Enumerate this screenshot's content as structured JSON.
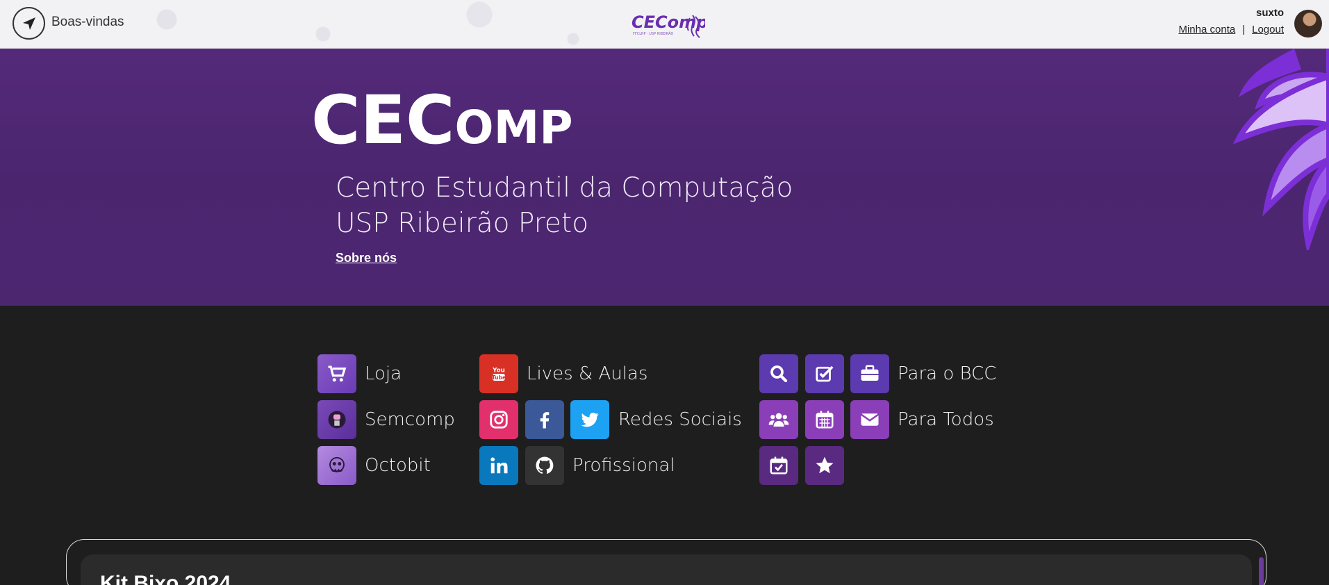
{
  "header": {
    "welcome_label": "Boas-vindas",
    "logo_text": "CEComp",
    "user_name": "suxto",
    "my_account_label": "Minha conta",
    "separator": "|",
    "logout_label": "Logout"
  },
  "hero": {
    "title_big": "CEC",
    "title_small": "OMP",
    "subtitle_line1": "Centro Estudantil da Computação",
    "subtitle_line2": "USP Ribeirão Preto",
    "about_link": "Sobre nós"
  },
  "links": {
    "loja": "Loja",
    "semcomp": "Semcomp",
    "octobit": "Octobit",
    "lives": "Lives & Aulas",
    "redes": "Redes Sociais",
    "profissional": "Profissional",
    "bcc": "Para o BCC",
    "todos": "Para Todos"
  },
  "colors": {
    "hero_bg": "#4d2670",
    "youtube": "#d93025",
    "instagram": "#e1306c",
    "facebook": "#3b5998",
    "twitter": "#1da1f2",
    "linkedin": "#0a78bd",
    "github": "#333333",
    "purple_tile": "#6a3cb5"
  },
  "card": {
    "title": "Kit Bixo 2024"
  }
}
